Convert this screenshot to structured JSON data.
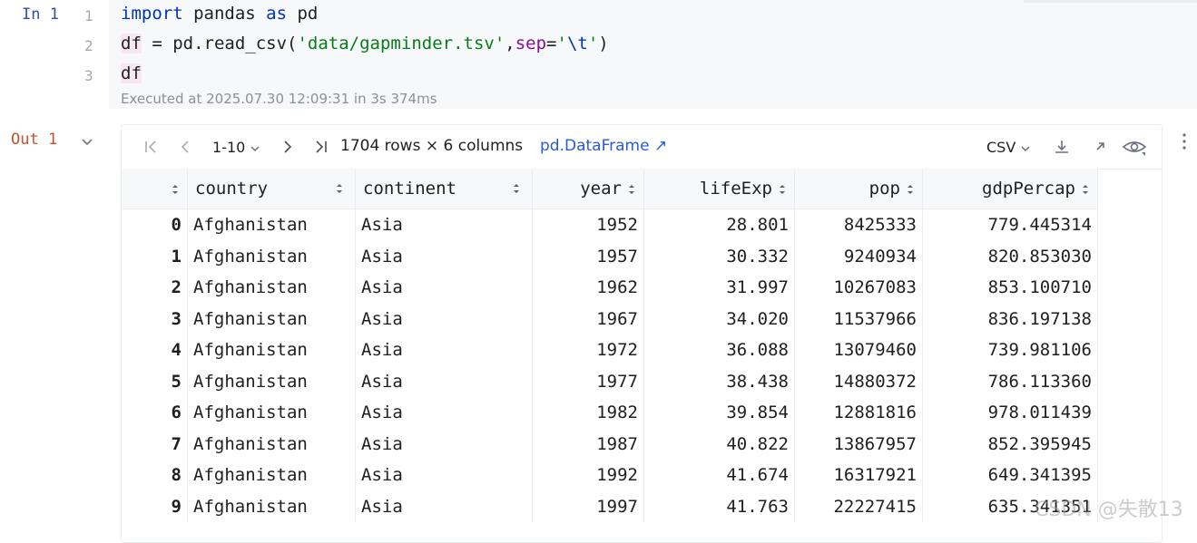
{
  "input_cell": {
    "prompt": "In 1",
    "lines": [
      {
        "num": "1"
      },
      {
        "num": "2"
      },
      {
        "num": "3"
      }
    ],
    "code": {
      "l1_kw_import": "import",
      "l1_mod": " pandas ",
      "l1_kw_as": "as",
      "l1_alias": " pd",
      "l2_var": "df",
      "l2_mid": " = pd.read_csv(",
      "l2_str": "'data/gapminder.tsv'",
      "l2_comma": ",",
      "l2_kwarg": "sep",
      "l2_eq": "=",
      "l2_q1": "'",
      "l2_esc": "\\t",
      "l2_q2": "'",
      "l2_close": ")",
      "l3": "df"
    },
    "executed": "Executed at 2025.07.30 12:09:31 in 3s 374ms"
  },
  "output_cell": {
    "prompt": "Out 1",
    "toolbar": {
      "pager": "1-10",
      "summary": "1704 rows × 6 columns",
      "type_link": "pd.DataFrame ↗",
      "export_format": "CSV"
    },
    "table": {
      "columns": [
        "",
        "country",
        "continent",
        "year",
        "lifeExp",
        "pop",
        "gdpPercap"
      ],
      "rows": [
        [
          "0",
          "Afghanistan",
          "Asia",
          "1952",
          "28.801",
          "8425333",
          "779.445314"
        ],
        [
          "1",
          "Afghanistan",
          "Asia",
          "1957",
          "30.332",
          "9240934",
          "820.853030"
        ],
        [
          "2",
          "Afghanistan",
          "Asia",
          "1962",
          "31.997",
          "10267083",
          "853.100710"
        ],
        [
          "3",
          "Afghanistan",
          "Asia",
          "1967",
          "34.020",
          "11537966",
          "836.197138"
        ],
        [
          "4",
          "Afghanistan",
          "Asia",
          "1972",
          "36.088",
          "13079460",
          "739.981106"
        ],
        [
          "5",
          "Afghanistan",
          "Asia",
          "1977",
          "38.438",
          "14880372",
          "786.113360"
        ],
        [
          "6",
          "Afghanistan",
          "Asia",
          "1982",
          "39.854",
          "12881816",
          "978.011439"
        ],
        [
          "7",
          "Afghanistan",
          "Asia",
          "1987",
          "40.822",
          "13867957",
          "852.395945"
        ],
        [
          "8",
          "Afghanistan",
          "Asia",
          "1992",
          "41.674",
          "16317921",
          "649.341395"
        ],
        [
          "9",
          "Afghanistan",
          "Asia",
          "1997",
          "41.763",
          "22227415",
          "635.341351"
        ]
      ]
    }
  },
  "watermark": "CSDN @失散13",
  "colors": {
    "keyword": "#0033b3",
    "string": "#067d17",
    "kwarg": "#871094",
    "prompt_in": "#2f4fb4",
    "prompt_out": "#c94f2b",
    "link": "#2a5bd7"
  }
}
